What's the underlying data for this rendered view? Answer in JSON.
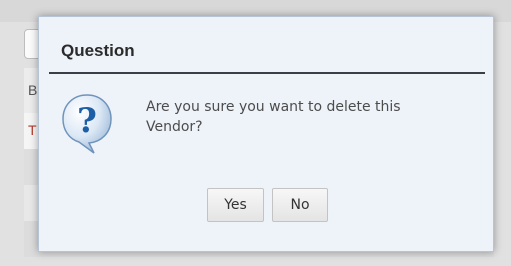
{
  "background": {
    "rows": [
      {
        "label": "B"
      },
      {
        "label": "T"
      }
    ]
  },
  "dialog": {
    "title": "Question",
    "icon": "question-icon",
    "message_line1": "Are you sure you want to delete this",
    "message_line2": "Vendor?",
    "buttons": {
      "yes_label": "Yes",
      "no_label": "No"
    }
  },
  "colors": {
    "dialog_background": "#eef3fa",
    "icon_blue": "#1d5fa6",
    "divider": "#3a3f47",
    "row_text_red": "#b23a2e"
  }
}
